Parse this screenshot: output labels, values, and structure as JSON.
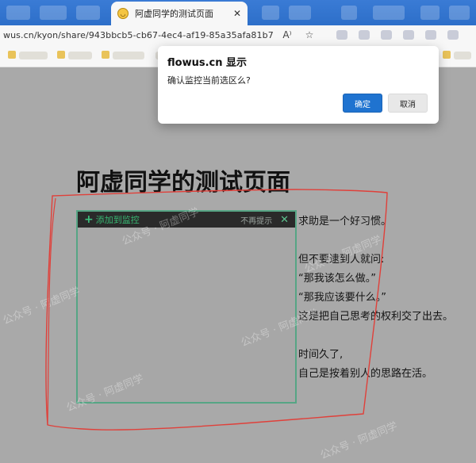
{
  "browser": {
    "tab_title": "阿虚同学的测试页面",
    "tab_close_glyph": "✕",
    "url": "wus.cn/kyon/share/943bbcb5-cb67-4ec4-af19-85a35afa81b7",
    "read_aloud_glyph": "A⁾",
    "favorite_glyph": "☆"
  },
  "page": {
    "title": "阿虚同学的测试页面",
    "paragraphs": [
      [
        "求助是一个好习惯。"
      ],
      [
        "但不要逮到人就问:",
        "“那我该怎么做。”",
        "“那我应该要什么。”",
        "这是把自己思考的权利交了出去。"
      ],
      [
        "时间久了,",
        "自己是按着别人的思路在活。"
      ]
    ]
  },
  "monitor": {
    "add_label": "添加到监控",
    "plus_glyph": "+",
    "no_remind": "不再提示",
    "close_glyph": "✕"
  },
  "dialog": {
    "title": "flowus.cn 显示",
    "message": "确认监控当前选区么?",
    "ok_label": "确定",
    "cancel_label": "取消"
  },
  "watermark": {
    "text": "公众号 · 阿虚同学"
  },
  "colors": {
    "tabstrip": "#2d6fc9",
    "page_dim": "#a9a9a9",
    "monitor_border": "#56a585",
    "accent_green": "#37b873",
    "primary_button": "#1f73d0",
    "annotation_red": "#e0403a"
  }
}
